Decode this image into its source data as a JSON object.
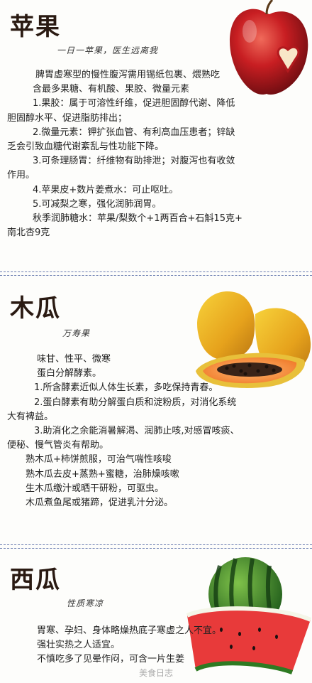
{
  "apple": {
    "title": "苹果",
    "subtitle": "一日一苹果，医生远离我",
    "lines": [
      "脾胃虚寒型的慢性腹泻需用锡纸包裹、煨熟吃",
      "含最多果糖、有机酸、果胶、微量元素",
      "1.果胶：属于可溶性纤维，促进胆固醇代谢、降低",
      "胆固醇水平、促进脂肪排出；",
      "2.微量元素：钾扩张血管、有利高血压患者；锌缺",
      "乏会引致血糖代谢紊乱与性功能下降。",
      "3.可条理肠胃：纤维物有助排泄；对腹泻也有收敛",
      "作用。",
      "4.苹果皮+数片姜煮水：可止呕吐。",
      "5.可减梨之寒，强化润肺润胃。",
      "秋季润肺糖水：苹果/梨数个+1两百合+石斛15克+",
      "南北杏9克"
    ]
  },
  "papaya": {
    "title": "木瓜",
    "subtitle": "万寿果",
    "lines": [
      "味甘、性平、微寒",
      "蛋白分解酵素。",
      "1.所含酵素近似人体生长素，多吃保持青春。",
      "2.蛋白酵素有助分解蛋白质和淀粉质，对消化系统",
      "大有裨益。",
      "3.助消化之余能消暑解渴、润肺止咳,对感冒咳痰、",
      "便秘、慢气管炎有帮助。",
      "熟木瓜+柿饼煎服，可治气喘性咳唆",
      "熟木瓜去皮+蒸熟+蜜糖，治肺燥咳嗽",
      "生木瓜缴汁或晒干研粉，可驱虫。",
      "木瓜煮鱼尾或猪蹄，促进乳汁分泌。"
    ]
  },
  "watermelon": {
    "title": "西瓜",
    "subtitle": "性质寒凉",
    "lines": [
      "胃寒、孕妇、身体略燥热底子寒虚之人不宜。",
      "强壮实热之人适宜。",
      "不慎吃多了见晕作闷，可含一片生姜"
    ]
  },
  "watermark": "美食日志"
}
